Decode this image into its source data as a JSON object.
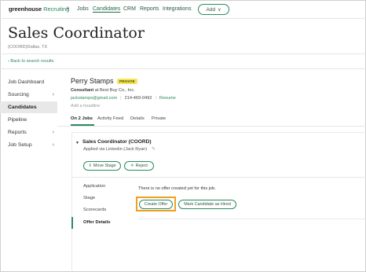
{
  "nav": {
    "logo_brand": "greenhouse",
    "logo_product": "Recruiting",
    "items": [
      {
        "label": "Jobs",
        "active": false
      },
      {
        "label": "Candidates",
        "active": true
      },
      {
        "label": "CRM",
        "active": false
      },
      {
        "label": "Reports",
        "active": false
      },
      {
        "label": "Integrations",
        "active": false
      }
    ],
    "add_label": "Add"
  },
  "header": {
    "title": "Sales Coordinator",
    "subtitle": "(COORD)Dallas, TX",
    "back_link": "Back to search results"
  },
  "sidebar": {
    "items": [
      {
        "label": "Job Dashboard",
        "has_chevron": false,
        "active": false
      },
      {
        "label": "Sourcing",
        "has_chevron": true,
        "active": false
      },
      {
        "label": "Candidates",
        "has_chevron": false,
        "active": true
      },
      {
        "label": "Pipeline",
        "has_chevron": false,
        "active": false
      },
      {
        "label": "Reports",
        "has_chevron": true,
        "active": false
      },
      {
        "label": "Job Setup",
        "has_chevron": true,
        "active": false
      }
    ]
  },
  "candidate": {
    "name": "Perry Stamps",
    "badge": "PRIVATE",
    "role_label": "Consultant",
    "company": "at Best Buy Co., Inc.",
    "email": "jackstamps@gmail.com",
    "phone": "214-469-0492",
    "resume_label": "Resume",
    "headline_placeholder": "Add a headline"
  },
  "tabs": [
    {
      "label": "On 2 Jobs",
      "active": true
    },
    {
      "label": "Activity Feed",
      "active": false
    },
    {
      "label": "Details",
      "active": false
    },
    {
      "label": "Private",
      "active": false
    }
  ],
  "job": {
    "title": "Sales Coordinator (COORD)",
    "applied": "Applied via Linkedin (Jack Ryan)",
    "move_stage_label": "Move Stage",
    "reject_label": "Reject",
    "stages": [
      {
        "label": "Application",
        "active": false
      },
      {
        "label": "Stage",
        "active": false
      },
      {
        "label": "Scorecards",
        "active": false
      },
      {
        "label": "Offer Details",
        "active": true
      }
    ],
    "offer_message": "There is no offer created yet for this job.",
    "create_offer_label": "Create Offer",
    "mark_hired_label": "Mark Candidate as Hired"
  },
  "colors": {
    "brand_green": "#2d8a5e",
    "highlight_orange": "#f0a020",
    "badge_yellow": "#f4e55a"
  }
}
